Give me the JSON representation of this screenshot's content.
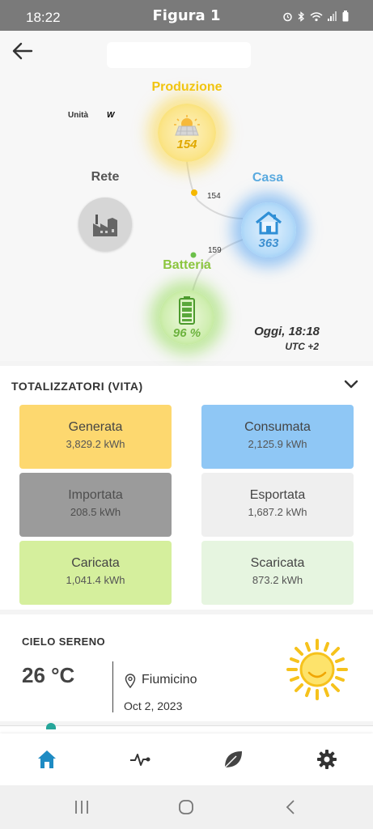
{
  "status_bar": {
    "time": "18:22",
    "title": "Figura 1",
    "icons": [
      "alarm-icon",
      "bluetooth-icon",
      "wifi-icon",
      "signal-icon",
      "battery-icon"
    ]
  },
  "header": {
    "back_icon": "arrow-left-icon"
  },
  "energy_flow": {
    "unit_label": "Unità",
    "unit_value": "W",
    "produzione": {
      "label": "Produzione",
      "value": "154",
      "icon": "solar-panel-icon",
      "color": "#f1c40f"
    },
    "rete": {
      "label": "Rete",
      "icon": "factory-icon",
      "color": "#555555"
    },
    "casa": {
      "label": "Casa",
      "value": "363",
      "icon": "house-icon",
      "color": "#5aaadf"
    },
    "batteria": {
      "label": "Batteria",
      "value": "96 %",
      "icon": "battery-icon",
      "color": "#8cc63f"
    },
    "flow_prod_to_casa": "154",
    "flow_batt_to_casa": "159",
    "datetime": "Oggi, 18:18",
    "timezone": "UTC +2"
  },
  "totals": {
    "title": "TOTALIZZATORI (VITA)",
    "tiles": [
      {
        "name": "Generata",
        "value": "3,829.2 kWh",
        "color": "#fdd86f"
      },
      {
        "name": "Consumata",
        "value": "2,125.9 kWh",
        "color": "#8fc7f5"
      },
      {
        "name": "Importata",
        "value": "208.5 kWh",
        "color": "#9b9b9b"
      },
      {
        "name": "Esportata",
        "value": "1,687.2 kWh",
        "color": "#efefef"
      },
      {
        "name": "Caricata",
        "value": "1,041.4 kWh",
        "color": "#d5ef9d"
      },
      {
        "name": "Scaricata",
        "value": "873.2 kWh",
        "color": "#e6f5e0"
      }
    ]
  },
  "weather": {
    "condition": "CIELO SERENO",
    "temperature": "26 °C",
    "location": "Fiumicino",
    "date": "Oct 2, 2023",
    "icon": "sun-icon"
  },
  "bottom_nav": {
    "items": [
      {
        "icon": "home-icon",
        "active": true
      },
      {
        "icon": "activity-icon",
        "active": false
      },
      {
        "icon": "leaf-icon",
        "active": false
      },
      {
        "icon": "gear-icon",
        "active": false
      }
    ],
    "active_color": "#1e8bc3"
  },
  "system_nav": {
    "items": [
      "recent-apps-icon",
      "home-circle-icon",
      "back-chevron-icon"
    ]
  }
}
